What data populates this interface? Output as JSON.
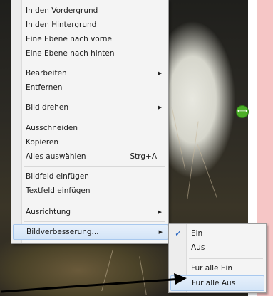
{
  "context_menu": {
    "items": [
      {
        "label": "In den Vordergrund"
      },
      {
        "label": "In den Hintergrund"
      },
      {
        "label": "Eine Ebene nach vorne"
      },
      {
        "label": "Eine Ebene nach hinten"
      },
      {
        "label": "Bearbeiten",
        "submenu": true
      },
      {
        "label": "Entfernen"
      },
      {
        "label": "Bild drehen",
        "submenu": true
      },
      {
        "label": "Ausschneiden"
      },
      {
        "label": "Kopieren"
      },
      {
        "label": "Alles auswählen",
        "shortcut": "Strg+A"
      },
      {
        "label": "Bildfeld einfügen"
      },
      {
        "label": "Textfeld einfügen"
      },
      {
        "label": "Ausrichtung",
        "submenu": true
      },
      {
        "label": "Bildverbesserung...",
        "submenu": true,
        "highlighted": true
      }
    ]
  },
  "submenu": {
    "items": [
      {
        "label": "Ein",
        "checked": true
      },
      {
        "label": "Aus"
      },
      {
        "label": "Für alle Ein"
      },
      {
        "label": "Für alle Aus",
        "highlighted": true
      }
    ]
  },
  "icons": {
    "checkmark": "checkmark-icon",
    "submenu_arrow": "submenu-arrow-icon",
    "resize_handle": "rotate-handle-icon"
  },
  "colors": {
    "highlight": "#d3e4f7",
    "highlight_border": "#a8c8ee",
    "check": "#1f5fbf",
    "handle": "#4caf28",
    "side_strip": "#f6c6c6"
  }
}
